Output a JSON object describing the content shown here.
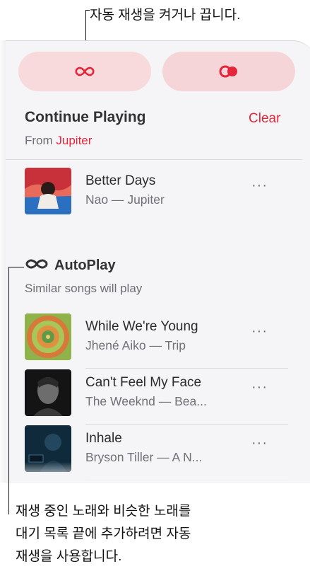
{
  "callouts": {
    "top": "자동 재생을 켜거나 끕니다.",
    "bottom_line1": "재생 중인 노래와 비슷한 노래를",
    "bottom_line2": "대기 목록 끝에 추가하려면 자동",
    "bottom_line3": "재생을 사용합니다."
  },
  "controls": {
    "autoplay_icon": "infinity-icon",
    "repeat_icon": "repeat-circles-icon"
  },
  "continue_playing": {
    "title": "Continue Playing",
    "clear_label": "Clear",
    "from_prefix": "From ",
    "from_source": "Jupiter",
    "items": [
      {
        "title": "Better Days",
        "subtitle": "Nao — Jupiter",
        "more": "···"
      }
    ]
  },
  "autoplay": {
    "title": "AutoPlay",
    "subtitle": "Similar songs will play",
    "items": [
      {
        "title": "While We're Young",
        "subtitle": "Jhené Aiko — Trip",
        "more": "···"
      },
      {
        "title": "Can't Feel My Face",
        "subtitle": "The Weeknd — Bea...",
        "more": "···"
      },
      {
        "title": "Inhale",
        "subtitle": "Bryson Tiller — A N...",
        "more": "···"
      }
    ]
  },
  "colors": {
    "accent": "#e5253a",
    "pill": "#f8dadd",
    "panel": "#f5f5f7"
  }
}
